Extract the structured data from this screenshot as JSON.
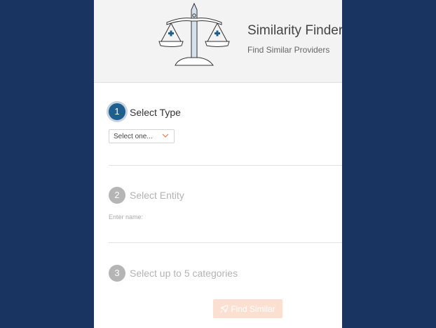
{
  "header": {
    "title": "Similarity Finder",
    "subtitle": "Find Similar Providers",
    "logo_icon": "scales-of-justice-icon"
  },
  "steps": [
    {
      "number": "1",
      "label": "Select Type",
      "state": "active"
    },
    {
      "number": "2",
      "label": "Select Entity",
      "state": "inactive"
    },
    {
      "number": "3",
      "label": "Select up to 5 categories",
      "state": "inactive"
    }
  ],
  "type_select": {
    "value": "Select one..."
  },
  "entity_input": {
    "label": "Enter name:"
  },
  "find_button": {
    "label": "Find Similar",
    "icon": "rocket-icon"
  },
  "colors": {
    "background": "#1a3462",
    "accent": "#1f5f8f",
    "button_disabled": "#fbe0d2",
    "chevron": "#e07b4f"
  }
}
